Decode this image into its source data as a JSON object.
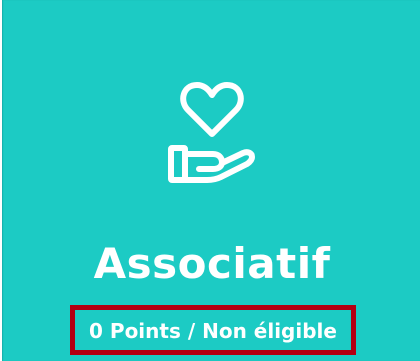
{
  "card": {
    "icon": "heart-in-hand-icon",
    "title": "Associatif",
    "status": "0 Points / Non éligible"
  },
  "colors": {
    "card_background": "#1ccbc4",
    "highlight_border": "#b40012",
    "text": "#ffffff"
  }
}
